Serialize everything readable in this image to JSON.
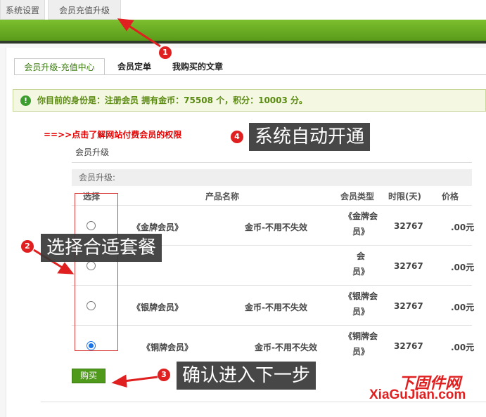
{
  "top_tabs": [
    "系统设置",
    "会员充值升级"
  ],
  "sub_tabs": [
    "会员升级-充值中心",
    "会员定单",
    "我购买的文章"
  ],
  "notice": "你目前的身份是：注册会员 拥有金币：75508 个，积分：10003 分。",
  "privilege_link": "==>>点击了解网站付费会员的权限",
  "section_title": "会员升级",
  "form_header": "会员升级:",
  "table": {
    "headers": [
      "选择",
      "产品名称",
      "会员类型",
      "时限(天)",
      "价格"
    ],
    "rows": [
      {
        "name": "《金牌会员》",
        "name_tail": "金币-不用不失效",
        "type_line1": "《金牌会",
        "type_line2": "员》",
        "days": "32767",
        "price": ".00元",
        "checked": false
      },
      {
        "name": "",
        "name_tail": "",
        "type_line1": "会",
        "type_line2": "员》",
        "days": "32767",
        "price": ".00元",
        "checked": false
      },
      {
        "name": "《银牌会员》",
        "name_tail": "金币-不用不失效",
        "type_line1": "《银牌会",
        "type_line2": "员》",
        "days": "32767",
        "price": ".00元",
        "checked": false
      },
      {
        "name": "《铜牌会员》",
        "name_tail": "金币-不用不失效",
        "type_line1": "《铜牌会",
        "type_line2": "员》",
        "days": "32767",
        "price": ".00元",
        "checked": true
      }
    ]
  },
  "buy_button": "购买",
  "annotations": {
    "badge1": "1",
    "badge2": "2",
    "badge3": "3",
    "badge4": "4",
    "callout2": "选择合适套餐",
    "callout3": "确认进入下一步",
    "callout4": "系统自动开通"
  },
  "watermark": {
    "cn": "下固件网",
    "en": "XiaGuJian.com"
  },
  "colors": {
    "green": "#5a9a1a",
    "alert_red": "#e02020",
    "notice_bg": "#f4f8e2"
  }
}
